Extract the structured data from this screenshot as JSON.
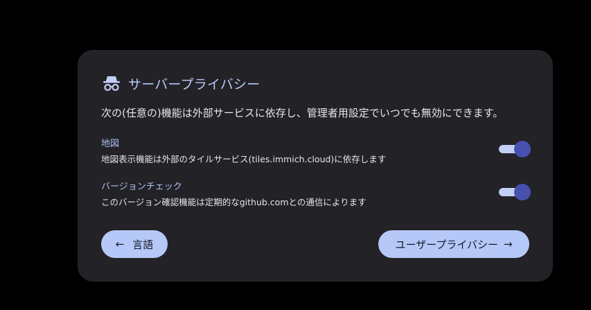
{
  "card": {
    "title": "サーバープライバシー",
    "title_icon": "incognito-icon",
    "description": "次の(任意の)機能は外部サービスに依存し、管理者用設定でいつでも無効にできます。"
  },
  "settings": [
    {
      "label": "地図",
      "description": "地図表示機能は外部のタイルサービス(tiles.immich.cloud)に依存します",
      "enabled": true
    },
    {
      "label": "バージョンチェック",
      "description": "このバージョン確認機能は定期的なgithub.comとの通信によります",
      "enabled": true
    }
  ],
  "buttons": {
    "back_label": "言語",
    "back_icon": "arrow-left-icon",
    "back_arrow": "←",
    "next_label": "ユーザープライバシー",
    "next_icon": "arrow-right-icon",
    "next_arrow": "→"
  },
  "colors": {
    "background": "#000000",
    "card": "#232226",
    "accent_text": "#b8c8f8",
    "button": "#b5c8f8",
    "toggle_track": "#c3cff6",
    "toggle_thumb": "#4750ad"
  }
}
